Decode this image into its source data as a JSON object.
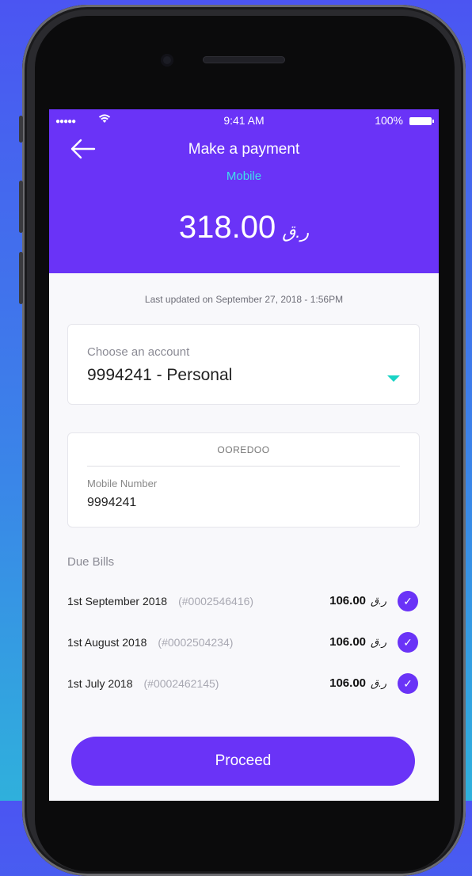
{
  "status_bar": {
    "signal": "●●●●●",
    "time": "9:41 AM",
    "battery": "100%"
  },
  "header": {
    "title": "Make a payment",
    "subtitle": "Mobile",
    "amount": "318.00",
    "currency": "ر.ق"
  },
  "last_updated": "Last updated on September 27, 2018 - 1:56PM",
  "account": {
    "label": "Choose an account",
    "value": "9994241 - Personal"
  },
  "mobile": {
    "operator": "OOREDOO",
    "label": "Mobile Number",
    "value": "9994241"
  },
  "due_bills": {
    "label": "Due Bills",
    "items": [
      {
        "date": "1st September 2018",
        "ref": "(#0002546416)",
        "amount": "106.00",
        "currency": "ر.ق",
        "checked": true
      },
      {
        "date": "1st August 2018",
        "ref": "(#0002504234)",
        "amount": "106.00",
        "currency": "ر.ق",
        "checked": true
      },
      {
        "date": "1st July 2018",
        "ref": "(#0002462145)",
        "amount": "106.00",
        "currency": "ر.ق",
        "checked": true
      }
    ]
  },
  "proceed_label": "Proceed",
  "colors": {
    "primary": "#6a33f7",
    "accent": "#3fe0ea",
    "caret": "#19d3c5"
  }
}
